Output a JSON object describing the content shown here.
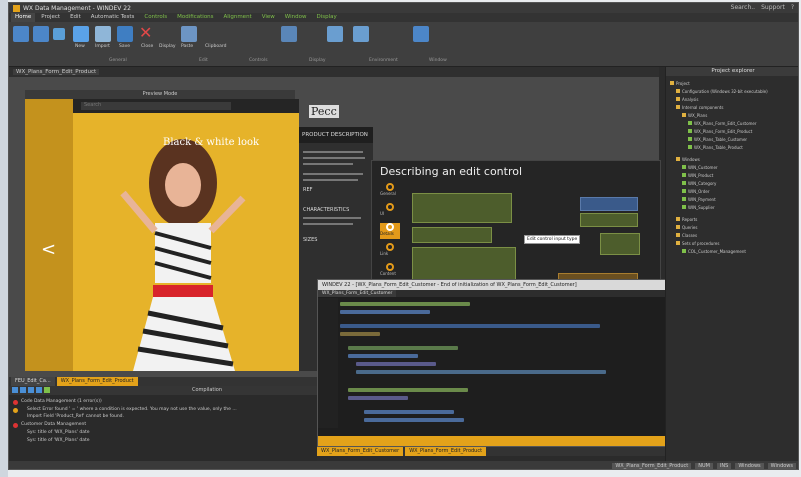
{
  "window": {
    "title": "WX Data Management - WINDEV 22",
    "title_right": [
      "Search..",
      "Support",
      "?"
    ]
  },
  "ribbon": {
    "tabs": [
      "Home",
      "Project",
      "Edit",
      "Automatic Tests",
      "Controls",
      "Modifications",
      "Alignment",
      "View",
      "Window",
      "Display"
    ],
    "active_tab": "Home",
    "buttons": [
      "New",
      "Import",
      "Save",
      "Close",
      "Display",
      "Paste",
      "Clipboard"
    ],
    "groups": [
      "General",
      "Edit",
      "Controls",
      "Display",
      "Environment",
      "Window"
    ]
  },
  "editor": {
    "doc_tab": "WX_Plans_Form_Edit_Product",
    "page_header": "Preview Mode",
    "search_placeholder": "Search",
    "look_title": "Black & white look",
    "brand_partial": "Pecc",
    "desc_title": "PRODUCT DESCRIPTION",
    "desc_sections": [
      "REF",
      "CHARACTERISTICS",
      "SIZES"
    ]
  },
  "help": {
    "title": "Describing an edit control",
    "steps": [
      "General",
      "UI",
      "Details",
      "Link",
      "Content",
      "Note",
      "Help",
      "Style"
    ],
    "tooltip": "Edit control input type"
  },
  "code": {
    "title": "WINDEV 22 - [WX_Plans_Form_Edit_Customer - End of initialization of WX_Plans_Form_Edit_Customer]",
    "tab": "WX_Plans_Form_Edit_Customer"
  },
  "bottom_tabs": [
    "FEU_Edit_Ca...",
    "WX_Plans_Form_Edit_Product"
  ],
  "bottom_tabs2": [
    "WX_Plans_Form_Edit_Customer",
    "WX_Plans_Form_Edit_Product"
  ],
  "compile": {
    "header": "Compilation",
    "rows": [
      "Code Data Management (1 error(s))",
      "Select Error found ' = ' where a condition is expected. You may not use the value, only the ...",
      "Import Field 'Product_Ref' cannot be found.",
      "Customer Data Management",
      "Sys: title of 'WX_Plans' date",
      "Sys: title of 'WX_Plans' date"
    ]
  },
  "explorer": {
    "title": "Project explorer",
    "rows": [
      "Project",
      "Configuration (Windows 32-bit executable)",
      "Analysis",
      "Internal components",
      "WX_Plans",
      "WX_Plans_Form_Edit_Customer",
      "WX_Plans_Form_Edit_Product",
      "WX_Plans_Table_Customer",
      "WX_Plans_Table_Product",
      "Windows",
      "WIN_Customer",
      "WIN_Product",
      "WIN_Category",
      "WIN_Order",
      "WIN_Payment",
      "WIN_Supplier",
      "Reports",
      "Queries",
      "Classes",
      "Sets of procedures",
      "COL_Customer_Management"
    ]
  },
  "status": {
    "left": "",
    "right": [
      "WX_Plans_Form_Edit_Product",
      "NUM",
      "INS",
      "Windows",
      "Windows"
    ]
  }
}
